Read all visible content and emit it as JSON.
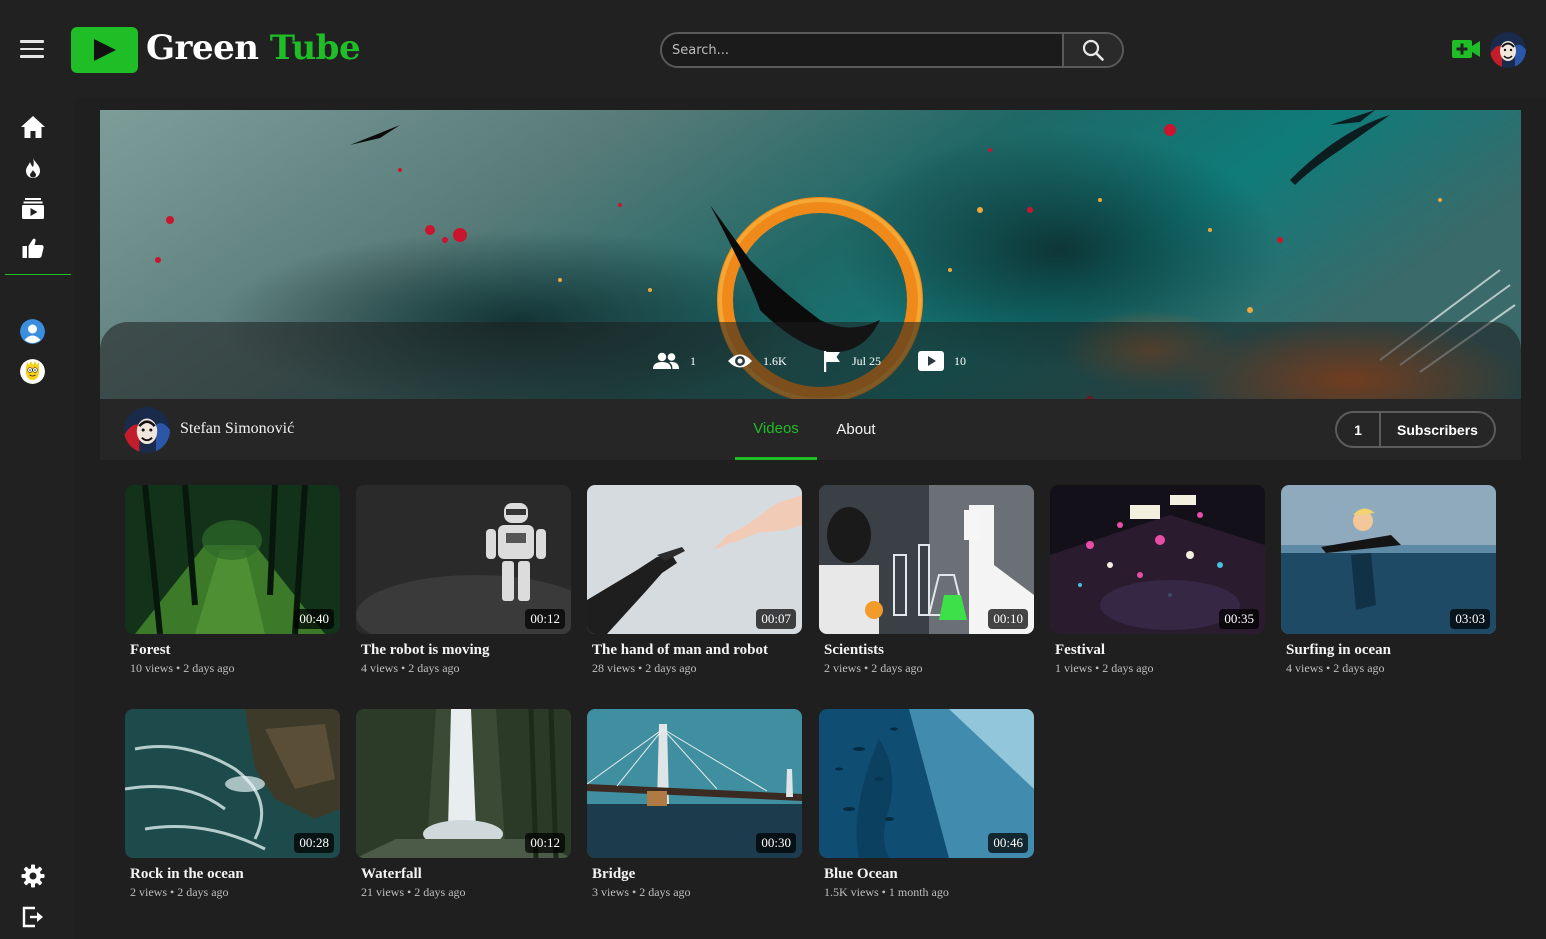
{
  "app": {
    "brand_word1": "Green",
    "brand_word2": "Tube",
    "accent": "#1fbd26"
  },
  "search": {
    "placeholder": "Search..."
  },
  "header": {
    "upload_icon": "video-plus-icon",
    "avatar_icon": "anonymous-mask-avatar"
  },
  "sidebar": {
    "items": [
      "home-icon",
      "fire-icon",
      "subscriptions-icon",
      "thumbs-up-icon"
    ],
    "subscriptions": [
      "default-user-avatar",
      "simpsons-avatar"
    ],
    "bottom": [
      "gear-icon",
      "logout-icon"
    ]
  },
  "banner": {
    "stats": {
      "subscribers": "1",
      "views": "1.6K",
      "joined": "Jul 25",
      "videos": "10"
    }
  },
  "channel": {
    "name": "Stefan Simonović",
    "tabs": {
      "videos": "Videos",
      "about": "About"
    },
    "subscriber_count": "1",
    "subscribe_label": "Subscribers"
  },
  "videos": [
    {
      "title": "Forest",
      "meta": "10 views • 2 days ago",
      "duration": "00:40"
    },
    {
      "title": "The robot is moving",
      "meta": "4 views • 2 days ago",
      "duration": "00:12"
    },
    {
      "title": "The hand of man and robot",
      "meta": "28 views • 2 days ago",
      "duration": "00:07"
    },
    {
      "title": "Scientists",
      "meta": "2 views • 2 days ago",
      "duration": "00:10"
    },
    {
      "title": "Festival",
      "meta": "1 views • 2 days ago",
      "duration": "00:35"
    },
    {
      "title": "Surfing in ocean",
      "meta": "4 views • 2 days ago",
      "duration": "03:03"
    },
    {
      "title": "Rock in the ocean",
      "meta": "2 views • 2 days ago",
      "duration": "00:28"
    },
    {
      "title": "Waterfall",
      "meta": "21 views • 2 days ago",
      "duration": "00:12"
    },
    {
      "title": "Bridge",
      "meta": "3 views • 2 days ago",
      "duration": "00:30"
    },
    {
      "title": "Blue Ocean",
      "meta": "1.5K views • 1 month ago",
      "duration": "00:46"
    }
  ]
}
